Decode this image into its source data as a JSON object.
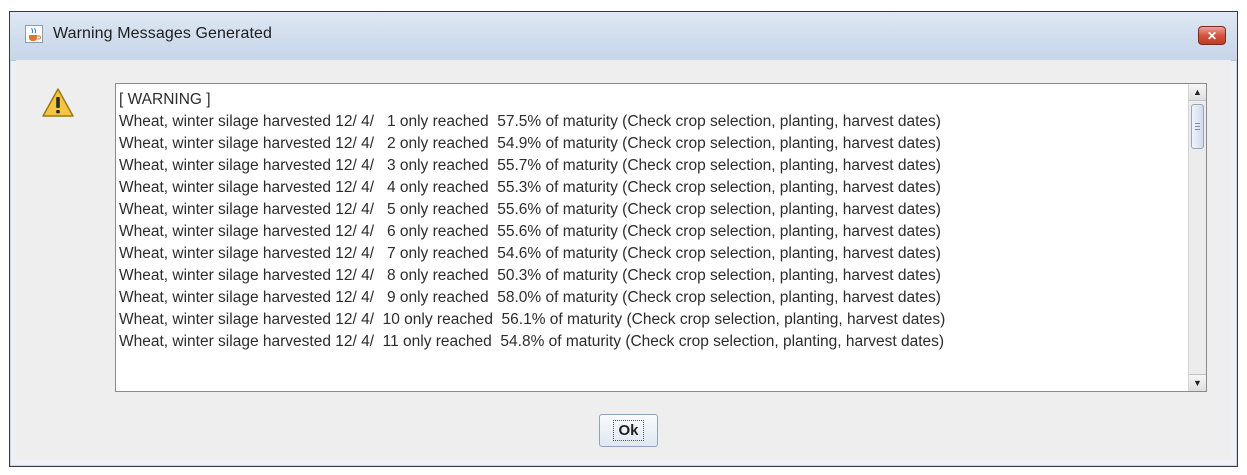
{
  "window": {
    "title": "Warning Messages Generated",
    "close_label": "✕"
  },
  "icons": {
    "title": "java-cup-icon",
    "warning": "warning-triangle-icon"
  },
  "messages": {
    "lines": [
      "[ WARNING ]",
      "Wheat, winter silage harvested 12/ 4/   1 only reached  57.5% of maturity (Check crop selection, planting, harvest dates)",
      "Wheat, winter silage harvested 12/ 4/   2 only reached  54.9% of maturity (Check crop selection, planting, harvest dates)",
      "Wheat, winter silage harvested 12/ 4/   3 only reached  55.7% of maturity (Check crop selection, planting, harvest dates)",
      "Wheat, winter silage harvested 12/ 4/   4 only reached  55.3% of maturity (Check crop selection, planting, harvest dates)",
      "Wheat, winter silage harvested 12/ 4/   5 only reached  55.6% of maturity (Check crop selection, planting, harvest dates)",
      "Wheat, winter silage harvested 12/ 4/   6 only reached  55.6% of maturity (Check crop selection, planting, harvest dates)",
      "Wheat, winter silage harvested 12/ 4/   7 only reached  54.6% of maturity (Check crop selection, planting, harvest dates)",
      "Wheat, winter silage harvested 12/ 4/   8 only reached  50.3% of maturity (Check crop selection, planting, harvest dates)",
      "Wheat, winter silage harvested 12/ 4/   9 only reached  58.0% of maturity (Check crop selection, planting, harvest dates)",
      "Wheat, winter silage harvested 12/ 4/  10 only reached  56.1% of maturity (Check crop selection, planting, harvest dates)",
      "Wheat, winter silage harvested 12/ 4/  11 only reached  54.8% of maturity (Check crop selection, planting, harvest dates)"
    ]
  },
  "scrollbar": {
    "up_arrow": "▲",
    "down_arrow": "▼"
  },
  "buttons": {
    "ok_label": "Ok"
  },
  "colors": {
    "close_button": "#c23b26",
    "warning_fill": "#f5c542",
    "titlebar": "#cfdcec"
  }
}
